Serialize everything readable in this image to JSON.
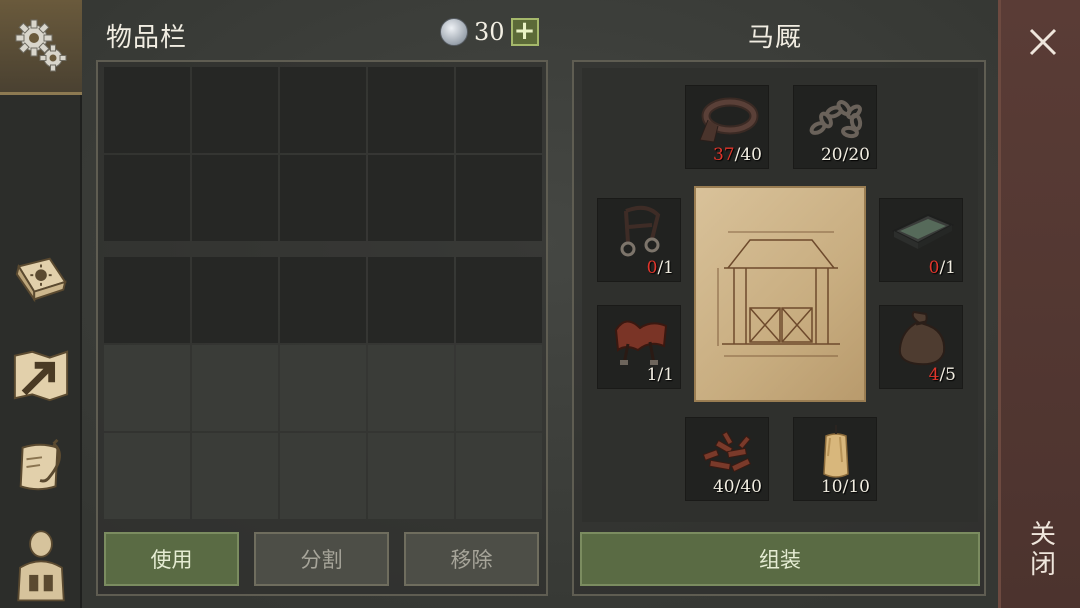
{
  "inventory": {
    "title": "物品栏",
    "currency": {
      "icon": "silver-coin-icon",
      "value": "30",
      "add_label": "+"
    },
    "buttons": {
      "use": "使用",
      "split": "分割",
      "remove": "移除"
    }
  },
  "crafting": {
    "title": "马厩",
    "assemble_label": "组装",
    "blueprint_icon": "stable-blueprint",
    "slots": [
      {
        "name": "leather-strap",
        "icon": "leather-strap-icon",
        "have": "37",
        "need": "40",
        "short": true
      },
      {
        "name": "iron-chain",
        "icon": "chain-icon",
        "have": "20",
        "need": "20",
        "short": false
      },
      {
        "name": "bridle",
        "icon": "bridle-icon",
        "have": "0",
        "need": "1",
        "short": true
      },
      {
        "name": "trough",
        "icon": "trough-icon",
        "have": "0",
        "need": "1",
        "short": true
      },
      {
        "name": "saddle",
        "icon": "saddle-icon",
        "have": "1",
        "need": "1",
        "short": false
      },
      {
        "name": "sack",
        "icon": "sack-icon",
        "have": "4",
        "need": "5",
        "short": true
      },
      {
        "name": "scrap-metal",
        "icon": "scrap-pile-icon",
        "have": "40",
        "need": "40",
        "short": false
      },
      {
        "name": "candle",
        "icon": "candle-icon",
        "have": "10",
        "need": "10",
        "short": false
      }
    ]
  },
  "close": {
    "label": "关闭"
  },
  "sidebar": {
    "items": [
      {
        "icon": "settings-gears-icon"
      },
      {
        "icon": "journal-book-icon"
      },
      {
        "icon": "map-arrow-icon"
      },
      {
        "icon": "quest-scroll-icon"
      },
      {
        "icon": "character-backpack-icon"
      }
    ]
  },
  "colors": {
    "accent_green": "#5a6b44",
    "shortage_red": "#e0352b",
    "close_panel": "#5a3c36"
  }
}
